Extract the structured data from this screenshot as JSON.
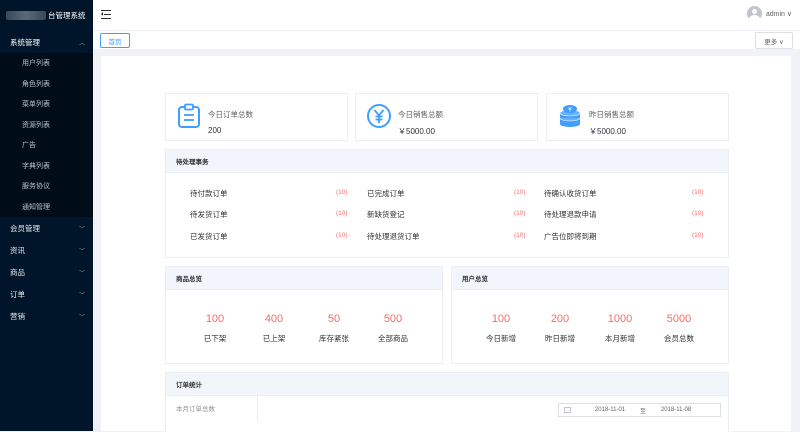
{
  "app": {
    "title": "台管理系统"
  },
  "sidebar": {
    "groups": [
      {
        "label": "系统管理",
        "arrow": "^",
        "items": [
          {
            "label": "用户列表"
          },
          {
            "label": "角色列表"
          },
          {
            "label": "菜单列表"
          },
          {
            "label": "资源列表"
          },
          {
            "label": "广告"
          },
          {
            "label": "字典列表"
          },
          {
            "label": "服务协议"
          },
          {
            "label": "通知管理"
          }
        ]
      },
      {
        "label": "会员管理",
        "arrow": "v"
      },
      {
        "label": "资讯",
        "arrow": "v"
      },
      {
        "label": "商品",
        "arrow": "v"
      },
      {
        "label": "订单",
        "arrow": "v"
      },
      {
        "label": "营销",
        "arrow": "v"
      }
    ]
  },
  "header": {
    "username": "admin ∨"
  },
  "tagbar": {
    "home": "首页",
    "more": "更多 ∨"
  },
  "stats": [
    {
      "label": "今日订单总数",
      "value": "200",
      "icon": "order-list-icon"
    },
    {
      "label": "今日销售总额",
      "value": "￥5000.00",
      "icon": "yen-circle-icon"
    },
    {
      "label": "昨日销售总额",
      "value": "￥5000.00",
      "icon": "coin-stack-icon"
    }
  ],
  "pending": {
    "title": "待处理事务",
    "items": [
      {
        "label": "待付款订单",
        "count": "(10)"
      },
      {
        "label": "已完成订单",
        "count": "(10)"
      },
      {
        "label": "待确认收货订单",
        "count": "(10)"
      },
      {
        "label": "待发货订单",
        "count": "(10)"
      },
      {
        "label": "新缺货登记",
        "count": "(10)"
      },
      {
        "label": "待处理退款申请",
        "count": "(10)"
      },
      {
        "label": "已发货订单",
        "count": "(10)"
      },
      {
        "label": "待处理退货订单",
        "count": "(10)"
      },
      {
        "label": "广告位即将到期",
        "count": "(10)"
      }
    ]
  },
  "goods": {
    "title": "商品总览",
    "items": [
      {
        "value": "100",
        "label": "已下架"
      },
      {
        "value": "400",
        "label": "已上架"
      },
      {
        "value": "50",
        "label": "库存紧张"
      },
      {
        "value": "500",
        "label": "全部商品"
      }
    ]
  },
  "users": {
    "title": "用户总览",
    "items": [
      {
        "value": "100",
        "label": "今日新增"
      },
      {
        "value": "200",
        "label": "昨日新增"
      },
      {
        "value": "1000",
        "label": "本月新增"
      },
      {
        "value": "5000",
        "label": "会员总数"
      }
    ]
  },
  "orders": {
    "title": "订单统计",
    "month_label": "本月订单总数",
    "date_from": "2018-11-01",
    "date_sep": "至",
    "date_to": "2018-11-08"
  },
  "colors": {
    "sidebar": "#001529",
    "accent": "#409eff",
    "count": "#f56c6c"
  }
}
